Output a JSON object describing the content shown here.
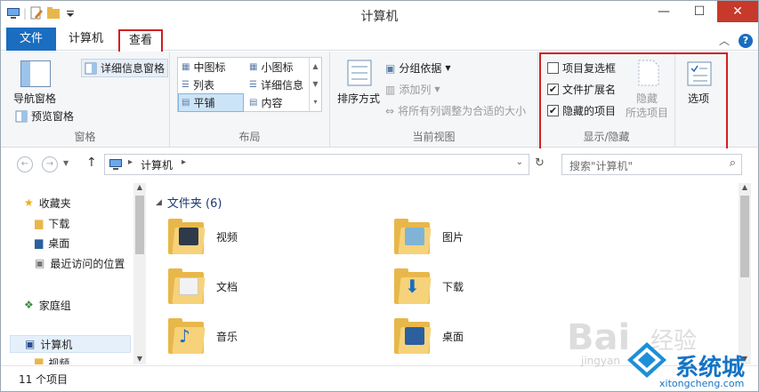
{
  "window": {
    "title": "计算机",
    "controls": {
      "minimize": "—",
      "maximize": "☐",
      "close": "✕"
    }
  },
  "ribbon_tabs": [
    {
      "label": "文件"
    },
    {
      "label": "计算机"
    },
    {
      "label": "查看"
    }
  ],
  "ribbon": {
    "pane_group": {
      "nav_pane": "导航窗格",
      "preview_pane": "预览窗格",
      "details_pane": "详细信息窗格",
      "label": "窗格"
    },
    "layout_group": {
      "items": [
        "中图标",
        "小图标",
        "列表",
        "详细信息",
        "平铺",
        "内容"
      ],
      "selected": "平铺",
      "label": "布局"
    },
    "current_view_group": {
      "sort_by": "排序方式",
      "group_by": "分组依据",
      "add_column": "添加列",
      "fit_columns": "将所有列调整为合适的大小",
      "label": "当前视图"
    },
    "show_hide_group": {
      "item_checkboxes": {
        "label": "项目复选框",
        "checked": false
      },
      "file_extensions": {
        "label": "文件扩展名",
        "checked": true
      },
      "hidden_items": {
        "label": "隐藏的项目",
        "checked": true
      },
      "hide_selected_line1": "隐藏",
      "hide_selected_line2": "所选项目",
      "label": "显示/隐藏"
    },
    "options": "选项"
  },
  "address_bar": {
    "path": "计算机",
    "search_placeholder": "搜索\"计算机\""
  },
  "nav_pane": {
    "items": [
      "收藏夹",
      "下载",
      "桌面",
      "最近访问的位置",
      "家庭组",
      "计算机",
      "视频"
    ]
  },
  "content": {
    "section_header": "文件夹 (6)",
    "folders": [
      "视频",
      "图片",
      "文档",
      "下载",
      "音乐",
      "桌面"
    ]
  },
  "status": {
    "item_count": "11 个项目"
  },
  "watermarks": {
    "baidu": "Bai",
    "baidu2": "经验",
    "baidu_url": "jingyan",
    "site_logo_text": "系统城",
    "site_url": "xitongcheng.com"
  },
  "colors": {
    "accent": "#1a6dbf",
    "highlight_box": "#d12020",
    "folder": "#e8b74a"
  }
}
